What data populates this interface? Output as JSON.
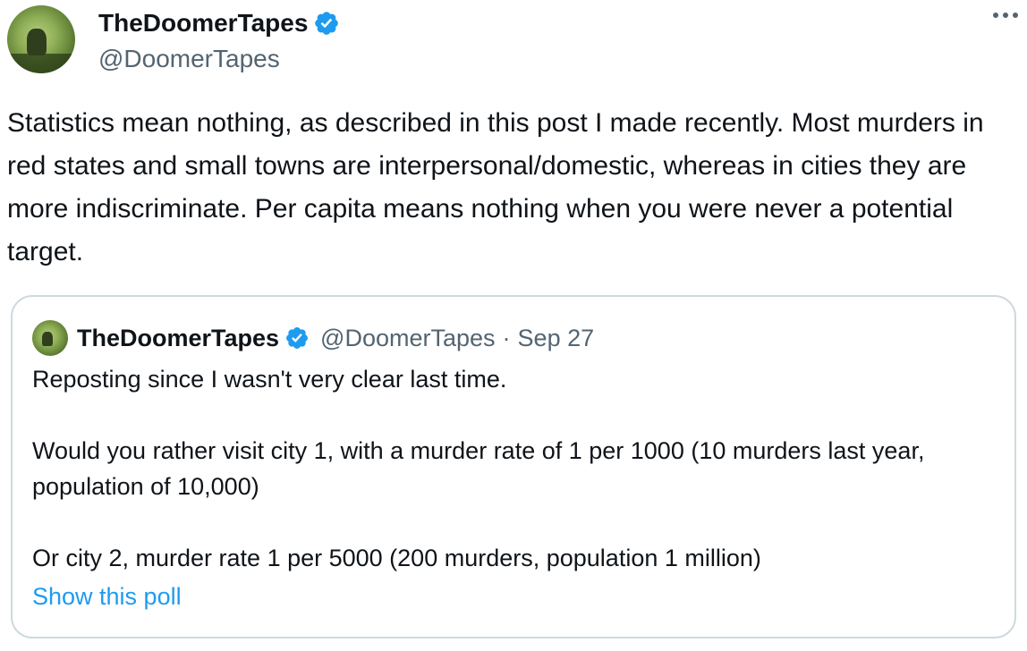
{
  "tweet": {
    "display_name": "TheDoomerTapes",
    "handle": "@DoomerTapes",
    "text": "Statistics mean nothing, as described in this post I made recently. Most murders in red states and small towns are interpersonal/domestic, whereas in cities they are more indiscriminate. Per capita means nothing when you were never a potential target.",
    "more_icon": "more-dots-icon",
    "verified_icon": "verified-badge-icon"
  },
  "quote": {
    "display_name": "TheDoomerTapes",
    "handle": "@DoomerTapes",
    "separator": "·",
    "date": "Sep 27",
    "line1": "Reposting since I wasn't very clear last time.",
    "line2": "Would you rather visit city 1, with a murder rate of 1 per 1000 (10 murders last year, population of 10,000)",
    "line3": "Or city 2, murder rate 1 per 5000 (200 murders, population 1 million)",
    "show_poll": "Show this poll"
  },
  "colors": {
    "text": "#0f1419",
    "secondary": "#536471",
    "link": "#1d9bf0",
    "verified": "#1d9bf0",
    "border": "#cfd9de"
  }
}
